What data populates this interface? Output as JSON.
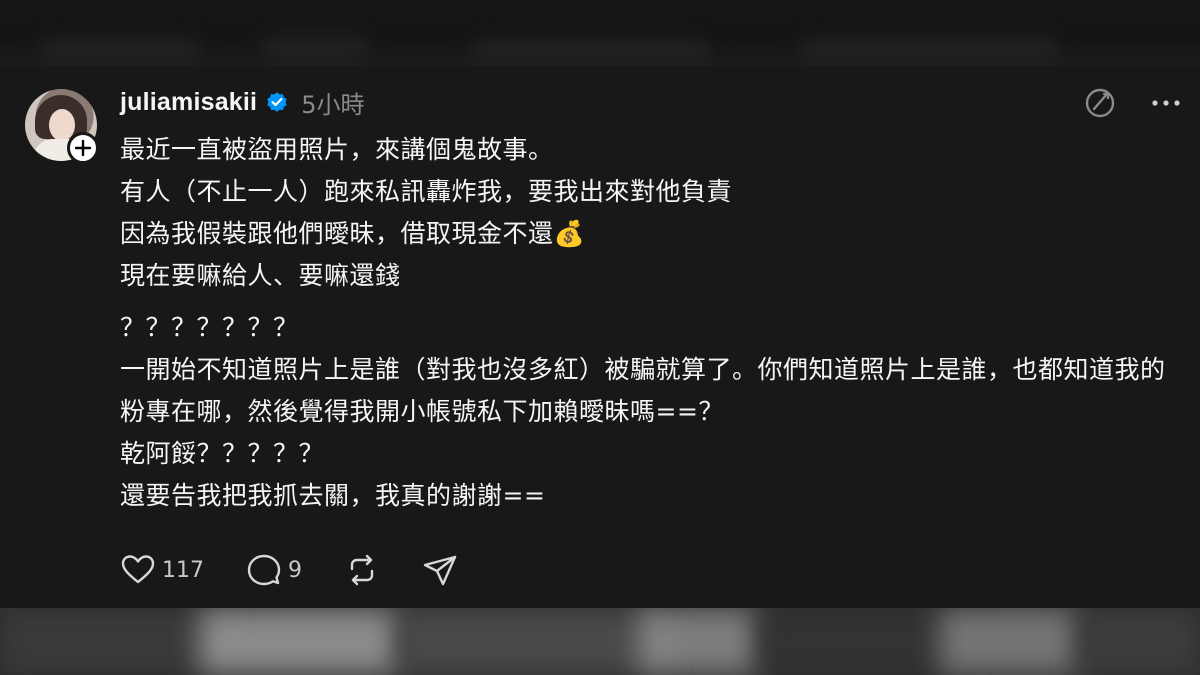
{
  "post": {
    "username": "juliamisakii",
    "time": "5小時",
    "paragraphs": [
      "最近一直被盜用照片，來講個鬼故事。\n有人（不止一人）跑來私訊轟炸我，要我出來對他負責\n因為我假裝跟他們曖昧，借取現金不還💰\n現在要嘛給人、要嘛還錢",
      "？？？？？？？\n一開始不知道照片上是誰（對我也沒多紅）被騙就算了。你們知道照片上是誰，也都知道我的粉專在哪，然後覺得我開小帳號私下加賴曖昧嗎==？\n乾阿餒？？？？？\n還要告我把我抓去關，我真的謝謝=="
    ]
  },
  "actions": {
    "likes": "117",
    "comments": "9"
  },
  "icons": {
    "verified": "verified-badge-icon",
    "follow": "plus-icon",
    "translate": "translate-icon",
    "more": "more-icon",
    "like": "heart-icon",
    "comment": "comment-icon",
    "repost": "repost-icon",
    "share": "send-icon"
  },
  "colors": {
    "background": "#181818",
    "verified": "#0095f6",
    "muted": "#8a8a8a"
  }
}
